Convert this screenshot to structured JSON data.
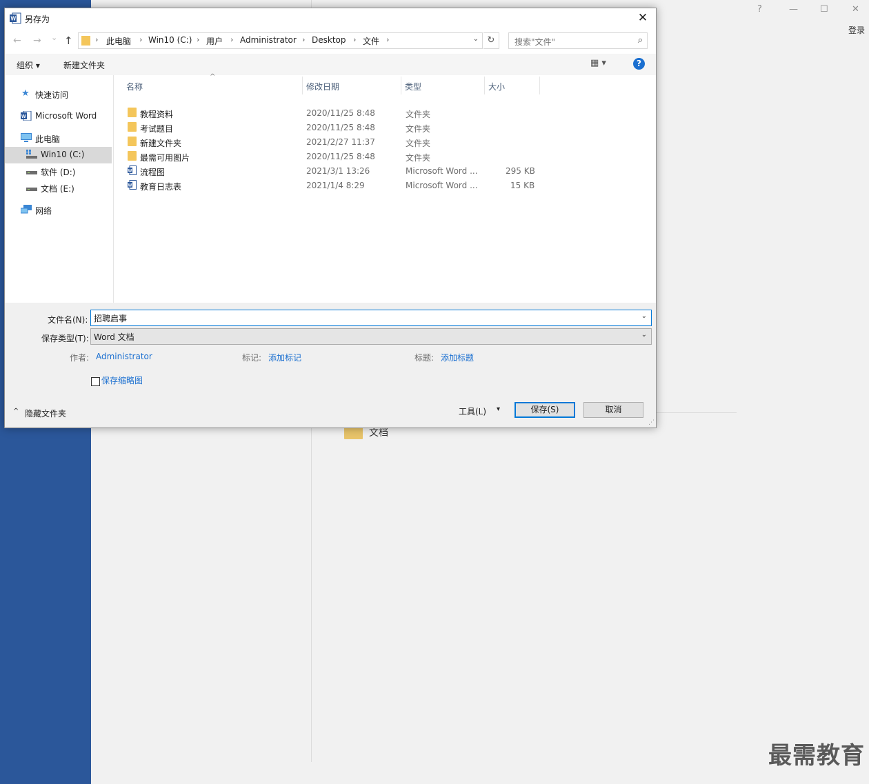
{
  "backstage": {
    "sign_in": "登录",
    "help_glyph": "?",
    "min_glyph": "—",
    "max_glyph": "☐",
    "close_glyph": "✕",
    "doc_label": "文档",
    "watermark": "最需教育",
    "accent_color": "#2b579a"
  },
  "dialog": {
    "title": "另存为",
    "close_glyph": "✕",
    "nav": {
      "back": "←",
      "forward": "→",
      "recent": "⌄",
      "up": "↑",
      "breadcrumbs": [
        "此电脑",
        "Win10 (C:)",
        "用户",
        "Administrator",
        "Desktop",
        "文件"
      ],
      "sep": "›",
      "dropdown": "⌄",
      "refresh": "↻",
      "search_placeholder": "搜索\"文件\"",
      "search_glyph": "⌕"
    },
    "toolbar": {
      "organize": "组织 ▾",
      "new_folder": "新建文件夹",
      "view_glyph": "▦ ▾",
      "help": "?"
    },
    "nav_pane": [
      {
        "label": "快速访问",
        "icon": "star-icon"
      },
      {
        "label": "Microsoft Word",
        "icon": "word-icon"
      },
      {
        "label": "此电脑",
        "icon": "computer-icon"
      },
      {
        "label": "Win10 (C:)",
        "icon": "drive-c-icon",
        "selected": true
      },
      {
        "label": "软件 (D:)",
        "icon": "drive-icon"
      },
      {
        "label": "文档 (E:)",
        "icon": "drive-icon"
      },
      {
        "label": "网络",
        "icon": "network-icon"
      }
    ],
    "columns": {
      "name": "名称",
      "date": "修改日期",
      "type": "类型",
      "size": "大小",
      "sort_glyph": "^"
    },
    "files": [
      {
        "name": "教程资料",
        "date": "2020/11/25 8:48",
        "type": "文件夹",
        "size": "",
        "icon": "folder-icon"
      },
      {
        "name": "考试题目",
        "date": "2020/11/25 8:48",
        "type": "文件夹",
        "size": "",
        "icon": "folder-icon"
      },
      {
        "name": "新建文件夹",
        "date": "2021/2/27 11:37",
        "type": "文件夹",
        "size": "",
        "icon": "folder-icon"
      },
      {
        "name": "最需可用图片",
        "date": "2020/11/25 8:48",
        "type": "文件夹",
        "size": "",
        "icon": "folder-icon"
      },
      {
        "name": "流程图",
        "date": "2021/3/1 13:26",
        "type": "Microsoft Word ...",
        "size": "295 KB",
        "icon": "word-doc-icon"
      },
      {
        "name": "教育日志表",
        "date": "2021/1/4 8:29",
        "type": "Microsoft Word ...",
        "size": "15 KB",
        "icon": "word-doc-icon"
      }
    ],
    "form": {
      "filename_label": "文件名(N):",
      "filename_value": "招聘启事",
      "type_label": "保存类型(T):",
      "type_value": "Word 文档",
      "author_label": "作者:",
      "author_value": "Administrator",
      "tags_label": "标记:",
      "tags_value": "添加标记",
      "title_label": "标题:",
      "title_value": "添加标题",
      "thumbnail_label": "保存缩略图",
      "hide_folders": "隐藏文件夹",
      "hide_glyph": "^",
      "tools": "工具(L)",
      "tools_drop": "▾",
      "save": "保存(S)",
      "cancel": "取消",
      "grip": "⋰"
    }
  }
}
